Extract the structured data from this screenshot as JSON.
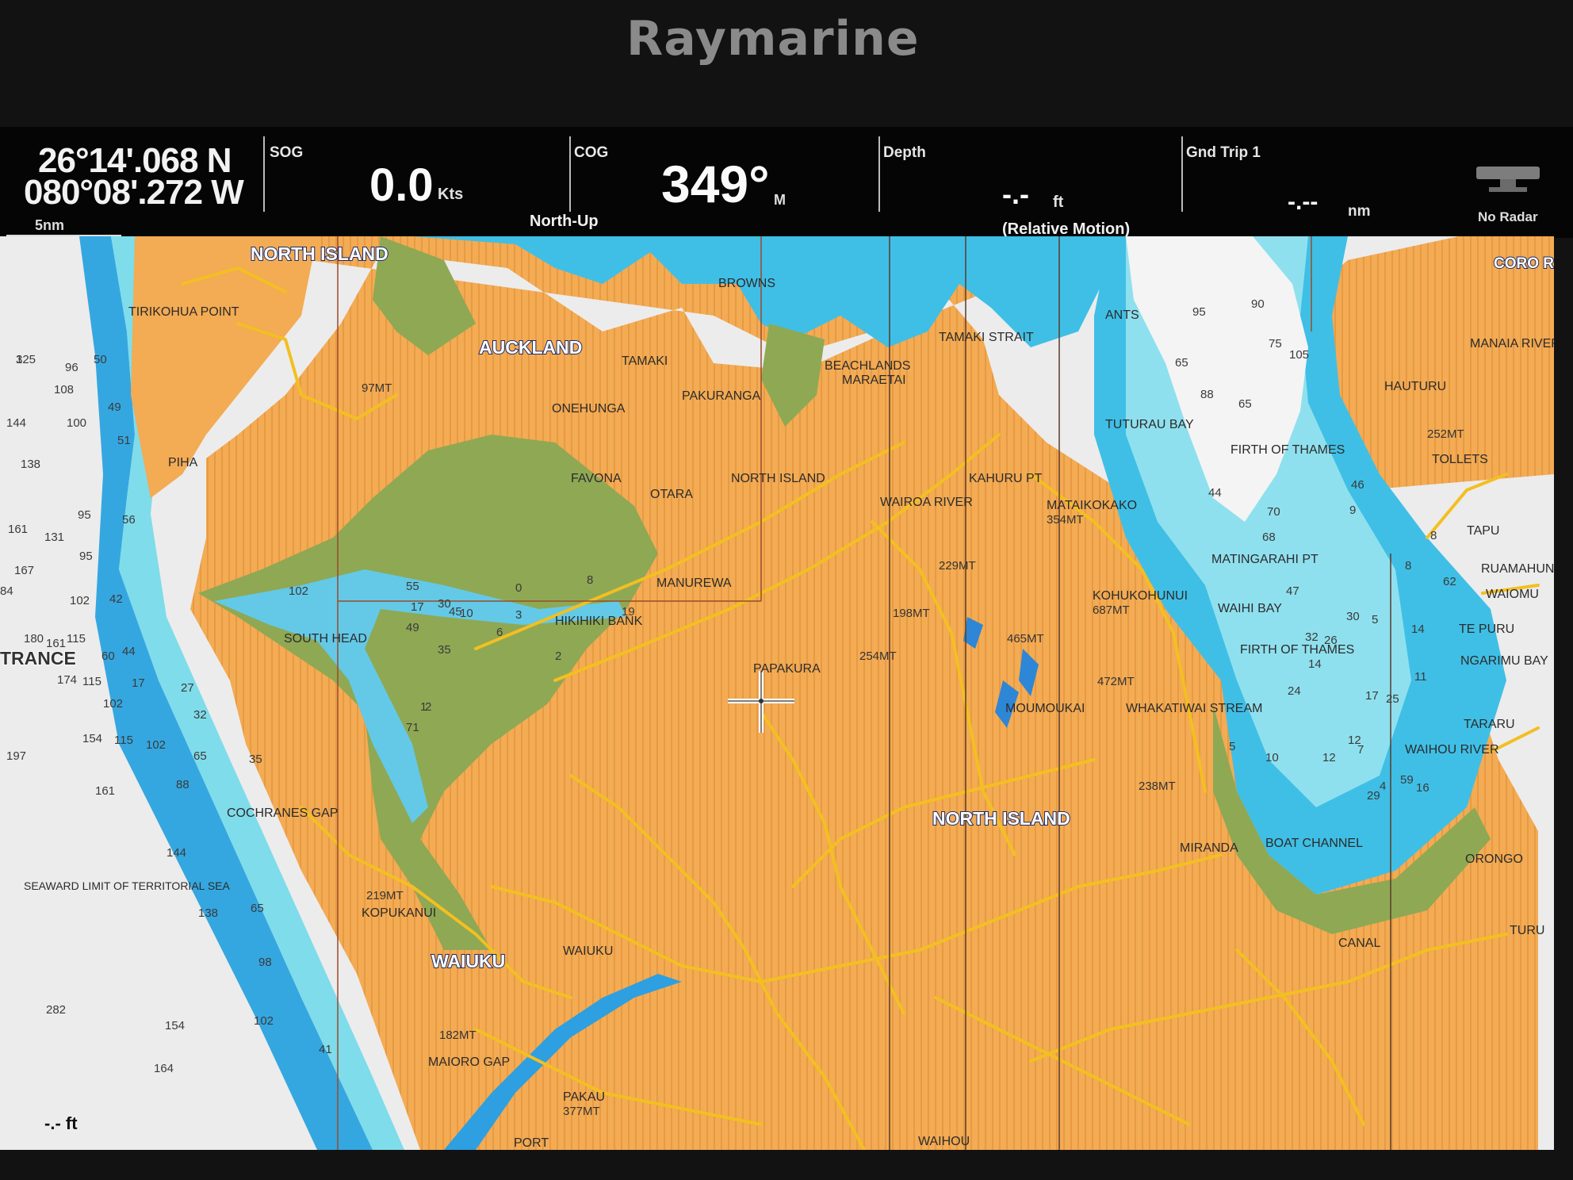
{
  "device": {
    "brand": "Raymarine"
  },
  "databar": {
    "position": {
      "lat": "26°14'.068 N",
      "lon": "080°08'.272 W"
    },
    "scale": "5nm",
    "sog": {
      "label": "SOG",
      "value": "0.0",
      "unit": "Kts"
    },
    "cog": {
      "label": "COG",
      "value": "349°",
      "unit": "M",
      "mode": "North-Up"
    },
    "depth": {
      "label": "Depth",
      "value": "-.-",
      "unit": "ft",
      "mode": "(Relative Motion)"
    },
    "gnd_trip": {
      "label": "Gnd Trip 1",
      "value": "-.--",
      "unit": "nm"
    },
    "radar": {
      "label": "No Radar"
    }
  },
  "map": {
    "places": {
      "north_island_top": "NORTH ISLAND",
      "auckland": "AUCKLAND",
      "tirikohua": "TIRIKOHUA POINT",
      "piha": "PIHA",
      "onehunga": "ONEHUNGA",
      "tamaki": "TAMAKI",
      "pakuranga": "PAKURANGA",
      "favona": "FAVONA",
      "otara": "OTARA",
      "north_island_mid": "NORTH ISLAND",
      "manurewa": "MANUREWA",
      "hikihiki": "HIKIHIKI BANK",
      "papakura": "PAPAKURA",
      "south_head": "SOUTH HEAD",
      "cochranes": "COCHRANES GAP",
      "seaward": "SEAWARD LIMIT OF TERRITORIAL SEA",
      "kopukanui": "KOPUKANUI",
      "waiuku_big": "WAIUKU",
      "waiuku_small": "WAIUKU",
      "maioro": "MAIORO GAP",
      "pakau": "PAKAU",
      "port": "PORT",
      "waihou_bottom": "WAIHOU",
      "north_island_big": "NORTH ISLAND",
      "beachlands": "BEACHLANDS",
      "maraetai": "MARAETAI",
      "tamaki_strait": "TAMAKI STRAIT",
      "wairoa": "WAIROA RIVER",
      "kahuru": "KAHURU PT",
      "mataikokako": "MATAIKOKAKO",
      "tuturau": "TUTURAU BAY",
      "firth1": "FIRTH OF THAMES",
      "firth2": "FIRTH OF THAMES",
      "matingarahi": "MATINGARAHI PT",
      "waihi_bay": "WAIHI BAY",
      "kohukohunui": "KOHUKOHUNUI",
      "moumoukai": "MOUMOUKAI",
      "whakatiwai": "WHAKATIWAI STREAM",
      "miranda": "MIRANDA",
      "boat_channel": "BOAT CHANNEL",
      "canal": "CANAL",
      "hauturu": "HAUTURU",
      "manaia": "MANAIA RIVER",
      "tolletts": "TOLLETS",
      "tapu": "TAPU",
      "ruamahunga": "RUAMAHUN",
      "waiomu": "WAIOMU",
      "te_puru": "TE PURU",
      "ngarimu": "NGARIMU BAY",
      "tararu": "TARARU",
      "waihou_river": "WAIHOU RIVER",
      "orongo": "ORONGO",
      "turua": "TURU",
      "coro": "CORO RANG",
      "trance": "TRANCE",
      "ants": "ANTS",
      "browns": "BROWNS"
    },
    "heights": {
      "h97": "97MT",
      "h229": "229MT",
      "h198": "198MT",
      "h254": "254MT",
      "h465": "465MT",
      "h354": "354MT",
      "h687": "687MT",
      "h472": "472MT",
      "h238": "238MT",
      "h219": "219MT",
      "h182": "182MT",
      "h377": "377MT",
      "h252": "252MT"
    },
    "soundings": [
      "125",
      "96",
      "50",
      "108",
      "49",
      "144",
      "100",
      "51",
      "138",
      "161",
      "131",
      "95",
      "56",
      "167",
      "95",
      "84",
      "102",
      "42",
      "180",
      "161",
      "115",
      "44",
      "60",
      "174",
      "115",
      "17",
      "102",
      "27",
      "32",
      "154",
      "115",
      "102",
      "197",
      "65",
      "88",
      "35",
      "161",
      "144",
      "138",
      "65",
      "98",
      "282",
      "154",
      "102",
      "164",
      "41",
      "102",
      "55",
      "17",
      "30",
      "45",
      "10",
      "6",
      "49",
      "35",
      "71",
      "2",
      "0",
      "3",
      "8",
      "19",
      "2",
      "1",
      "95",
      "90",
      "75",
      "105",
      "65",
      "88",
      "65",
      "44",
      "70",
      "68",
      "46",
      "47",
      "30",
      "32",
      "26",
      "14",
      "24",
      "17",
      "11",
      "12",
      "7",
      "5",
      "10",
      "12",
      "25",
      "29",
      "59",
      "16",
      "4",
      "62",
      "8",
      "14",
      "5",
      "8",
      "9",
      "3"
    ],
    "bottom_depth": "-.- ft"
  }
}
